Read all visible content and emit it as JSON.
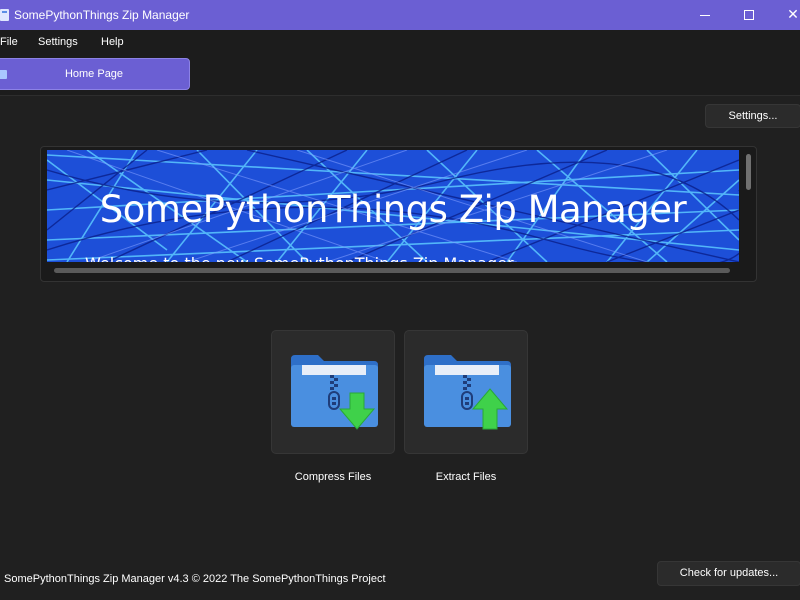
{
  "window": {
    "title": "SomePythonThings Zip Manager",
    "accent_color": "#6b5fd3",
    "background_color": "#202020"
  },
  "menu": {
    "items": [
      "File",
      "Settings",
      "Help"
    ]
  },
  "tabs": [
    {
      "label": "Home Page",
      "active": true
    }
  ],
  "toolbar": {
    "settings_label": "Settings..."
  },
  "banner": {
    "title": "SomePythonThings Zip Manager",
    "welcome": "Welcome to the new SomePythonThings Zip Manager"
  },
  "actions": [
    {
      "label": "Compress Files",
      "icon": "folder-zip-compress-icon"
    },
    {
      "label": "Extract Files",
      "icon": "folder-zip-extract-icon"
    }
  ],
  "footer": {
    "version_text": "SomePythonThings Zip Manager v4.3  © 2022 The SomePythonThings Project",
    "updates_label": "Check for updates..."
  }
}
